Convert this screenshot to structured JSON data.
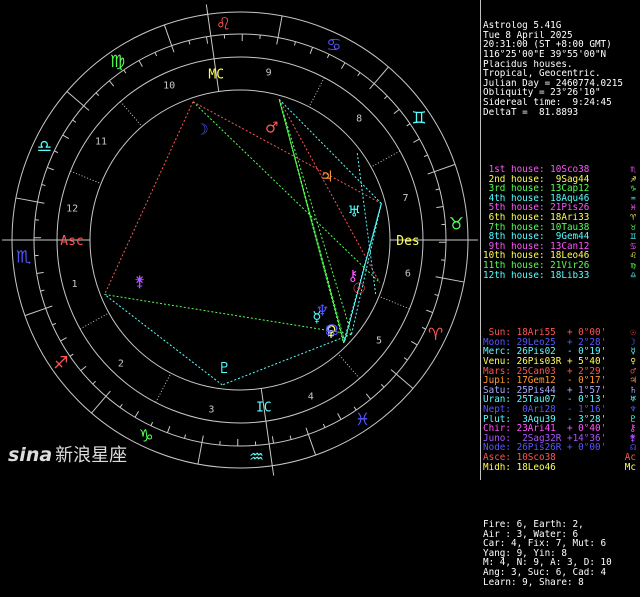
{
  "header": {
    "lines": [
      "Astrolog 5.41G",
      "Tue 8 April 2025",
      "20:31:00 (ST +8:00 GMT)",
      "116°25'00\"E 39°55'00\"N",
      "Placidus houses.",
      "Tropical, Geocentric.",
      "Julian Day = 2460774.0215",
      "Obliquity = 23°26'10\"",
      "Sidereal time:  9:24:45",
      "DeltaT =  81.8893"
    ]
  },
  "houses": [
    {
      "label": "1st house:",
      "value": "10Sco38",
      "color": "#ff55ff",
      "sym": "♏"
    },
    {
      "label": "2nd house:",
      "value": "9Sag44",
      "color": "#ffff55",
      "sym": "♐"
    },
    {
      "label": "3rd house:",
      "value": "13Cap12",
      "color": "#55ff55",
      "sym": "♑"
    },
    {
      "label": "4th house:",
      "value": "18Aqu46",
      "color": "#55ffff",
      "sym": "♒"
    },
    {
      "label": "5th house:",
      "value": "21Pis26",
      "color": "#ff55ff",
      "sym": "♓"
    },
    {
      "label": "6th house:",
      "value": "18Ari33",
      "color": "#ffff55",
      "sym": "♈"
    },
    {
      "label": "7th house:",
      "value": "10Tau38",
      "color": "#55ff55",
      "sym": "♉"
    },
    {
      "label": "8th house:",
      "value": "9Gem44",
      "color": "#55ffff",
      "sym": "♊"
    },
    {
      "label": "9th house:",
      "value": "13Can12",
      "color": "#ff55ff",
      "sym": "♋"
    },
    {
      "label": "10th house:",
      "value": "18Leo46",
      "color": "#ffff55",
      "sym": "♌"
    },
    {
      "label": "11th house:",
      "value": "21Vir26",
      "color": "#55ff55",
      "sym": "♍"
    },
    {
      "label": "12th house:",
      "value": "18Lib33",
      "color": "#55ffff",
      "sym": "♎"
    }
  ],
  "planets": [
    {
      "name": "Sun:",
      "value": "18Ari55",
      "rx": "",
      "speed": "+ 0°00'",
      "color": "#ff5555",
      "sym": "☉"
    },
    {
      "name": "Moon:",
      "value": "29Leo25",
      "rx": "",
      "speed": "+ 2°28'",
      "color": "#5555ff",
      "sym": "☽"
    },
    {
      "name": "Merc:",
      "value": "26Pis02",
      "rx": "",
      "speed": "- 0°19'",
      "color": "#55ffff",
      "sym": "☿"
    },
    {
      "name": "Venu:",
      "value": "26Pis03",
      "rx": "R",
      "speed": "+ 5°40'",
      "color": "#ffff55",
      "sym": "♀"
    },
    {
      "name": "Mars:",
      "value": "25Can03",
      "rx": "",
      "speed": "+ 2°29'",
      "color": "#ff5555",
      "sym": "♂"
    },
    {
      "name": "Jupi:",
      "value": "17Gem12",
      "rx": "",
      "speed": "- 0°17'",
      "color": "#ff9933",
      "sym": "♃"
    },
    {
      "name": "Satu:",
      "value": "25Pis44",
      "rx": "",
      "speed": "+ 1°57'",
      "color": "#aaaaff",
      "sym": "♄"
    },
    {
      "name": "Uran:",
      "value": "25Tau07",
      "rx": "",
      "speed": "- 0°13'",
      "color": "#55ffff",
      "sym": "♅"
    },
    {
      "name": "Nept:",
      "value": "0Ari28",
      "rx": "",
      "speed": "- 1°16'",
      "color": "#5555ff",
      "sym": "♆"
    },
    {
      "name": "Plut:",
      "value": "3Aqu39",
      "rx": "",
      "speed": "- 3°28'",
      "color": "#55ffff",
      "sym": "♇"
    },
    {
      "name": "Chir:",
      "value": "23Ari41",
      "rx": "",
      "speed": "+ 0°40'",
      "color": "#ff55ff",
      "sym": "⚷"
    },
    {
      "name": "Juno:",
      "value": "2Sag32",
      "rx": "R",
      "speed": "+14°36'",
      "color": "#aa55ff",
      "sym": "⚵"
    },
    {
      "name": "Node:",
      "value": "26Pis26",
      "rx": "R",
      "speed": "+ 0°00'",
      "color": "#5555ff",
      "sym": "☊"
    },
    {
      "name": "Asce:",
      "value": "10Sco38",
      "rx": "",
      "speed": "",
      "color": "#ff5555",
      "sym": "Ac"
    },
    {
      "name": "Midh:",
      "value": "18Leo46",
      "rx": "",
      "speed": "",
      "color": "#ffff55",
      "sym": "Mc"
    }
  ],
  "summary": [
    "Fire: 6, Earth: 2,",
    "Air : 3, Water: 6",
    "Car: 4, Fix: 7, Mut: 6",
    "Yang: 9, Yin: 8",
    "M: 4, N: 9, A: 3, D: 10",
    "Ang: 3, Suc: 6, Cad: 4",
    "Learn: 9, Share: 8"
  ],
  "chart_labels": {
    "asc": "Asc",
    "des": "Des",
    "mc": "MC",
    "ic": "IC",
    "house_numbers": [
      "1",
      "2",
      "3",
      "4",
      "5",
      "6",
      "7",
      "8",
      "9",
      "10",
      "11",
      "12"
    ]
  },
  "zodiac_signs": [
    "♈",
    "♉",
    "♊",
    "♋",
    "♌",
    "♍",
    "♎",
    "♏",
    "♐",
    "♑",
    "♒",
    "♓"
  ],
  "sign_colors": [
    "#ff5555",
    "#55ff55",
    "#55ffff",
    "#5555ff",
    "#ff5555",
    "#55ff55",
    "#55ffff",
    "#5555ff",
    "#ff5555",
    "#55ff55",
    "#55ffff",
    "#5555ff"
  ],
  "house_cusp_degrees": [
    220.633,
    249.733,
    283.2,
    318.767,
    351.433,
    18.55,
    40.633,
    69.733,
    103.2,
    138.767,
    171.433,
    198.55
  ],
  "planet_degrees": [
    {
      "sym": "☉",
      "deg": 18.917,
      "color": "#ff5555"
    },
    {
      "sym": "☽",
      "deg": 149.417,
      "color": "#5555ff"
    },
    {
      "sym": "☿",
      "deg": 356.033,
      "color": "#55ffff"
    },
    {
      "sym": "♀",
      "deg": 356.05,
      "color": "#ffff55"
    },
    {
      "sym": "♂",
      "deg": 115.05,
      "color": "#ff5555"
    },
    {
      "sym": "♃",
      "deg": 77.2,
      "color": "#ff9933"
    },
    {
      "sym": "♄",
      "deg": 355.733,
      "color": "#aaaaff"
    },
    {
      "sym": "♅",
      "deg": 55.117,
      "color": "#55ffff"
    },
    {
      "sym": "♆",
      "deg": 0.467,
      "color": "#5555ff"
    },
    {
      "sym": "♇",
      "deg": 303.65,
      "color": "#55ffff"
    },
    {
      "sym": "⚷",
      "deg": 23.683,
      "color": "#ff55ff"
    },
    {
      "sym": "⚵",
      "deg": 242.533,
      "color": "#aa55ff"
    },
    {
      "sym": "☊",
      "deg": 356.433,
      "color": "#5555ff"
    }
  ],
  "logo": {
    "brand": "sina",
    "cn": "新浪星座"
  }
}
